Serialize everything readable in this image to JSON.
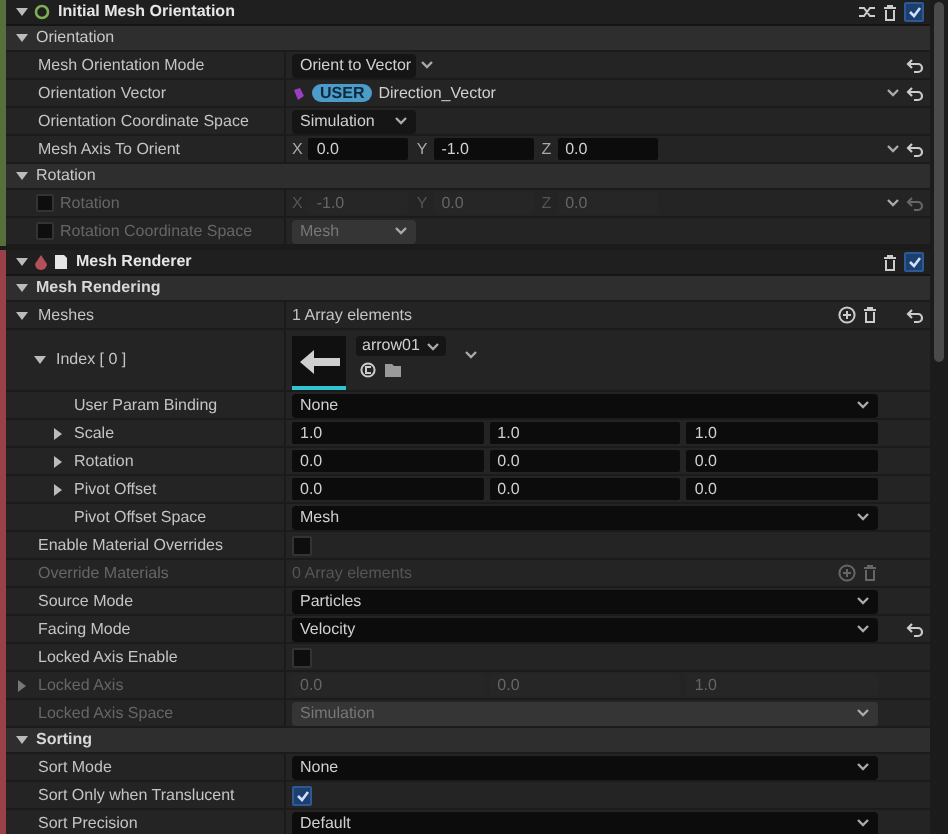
{
  "modules": [
    {
      "kind": "module",
      "title": "Initial Mesh Orientation",
      "color": "#55703a",
      "enabled": true,
      "expanded": true,
      "categories": [
        {
          "title": "Orientation",
          "expanded": true,
          "rows": [
            {
              "kind": "combo",
              "label": "Mesh Orientation Mode",
              "value": "Orient to Vector",
              "modified": true,
              "disabled": false
            },
            {
              "kind": "binding",
              "label": "Orientation Vector",
              "badge": "USER",
              "value": "Direction_Vector",
              "modified": true,
              "menu": true,
              "disabled": false
            },
            {
              "kind": "combo",
              "label": "Orientation Coordinate Space",
              "value": "Simulation",
              "modified": false,
              "disabled": false
            },
            {
              "kind": "vector",
              "label": "Mesh Axis To Orient",
              "fields": [
                {
                  "axis": "X",
                  "value": "0.0"
                },
                {
                  "axis": "Y",
                  "value": "-1.0"
                },
                {
                  "axis": "Z",
                  "value": "0.0"
                }
              ],
              "modified": true,
              "menu": true,
              "disabled": false
            }
          ]
        },
        {
          "title": "Rotation",
          "expanded": true,
          "rows": [
            {
              "kind": "vector",
              "label": "Rotation",
              "edit_condition": false,
              "fields": [
                {
                  "axis": "X",
                  "value": "-1.0"
                },
                {
                  "axis": "Y",
                  "value": "0.0"
                },
                {
                  "axis": "Z",
                  "value": "0.0"
                }
              ],
              "modified": true,
              "menu": true,
              "disabled": true
            },
            {
              "kind": "combo",
              "label": "Rotation Coordinate Space",
              "edit_condition": false,
              "value": "Mesh",
              "modified": false,
              "disabled": true
            }
          ]
        }
      ]
    },
    {
      "kind": "renderer",
      "title": "Mesh Renderer",
      "color": "#9a4048",
      "enabled": true,
      "expanded": true,
      "categories": [
        {
          "title": "Mesh Rendering",
          "expanded": true,
          "rows": [
            {
              "kind": "array",
              "label": "Meshes",
              "value": "1 Array elements",
              "expanded": true,
              "modified": true,
              "disabled": false,
              "children": [
                {
                  "kind": "mesh",
                  "label": "Index [ 0 ]",
                  "asset": "arrow01",
                  "expanded": true,
                  "disabled": false,
                  "children": [
                    {
                      "kind": "dropdown",
                      "label": "User Param Binding",
                      "value": "None",
                      "disabled": false
                    },
                    {
                      "kind": "vector3",
                      "label": "Scale",
                      "expanded": false,
                      "fields": [
                        {
                          "value": "1.0"
                        },
                        {
                          "value": "1.0"
                        },
                        {
                          "value": "1.0"
                        }
                      ],
                      "disabled": false
                    },
                    {
                      "kind": "vector3",
                      "label": "Rotation",
                      "expanded": false,
                      "fields": [
                        {
                          "value": "0.0"
                        },
                        {
                          "value": "0.0"
                        },
                        {
                          "value": "0.0"
                        }
                      ],
                      "disabled": false
                    },
                    {
                      "kind": "vector3",
                      "label": "Pivot Offset",
                      "expanded": false,
                      "fields": [
                        {
                          "value": "0.0"
                        },
                        {
                          "value": "0.0"
                        },
                        {
                          "value": "0.0"
                        }
                      ],
                      "disabled": false
                    },
                    {
                      "kind": "dropdown",
                      "label": "Pivot Offset Space",
                      "value": "Mesh",
                      "disabled": false
                    }
                  ]
                }
              ]
            },
            {
              "kind": "checkbox",
              "label": "Enable Material Overrides",
              "checked": false,
              "disabled": false
            },
            {
              "kind": "array",
              "label": "Override Materials",
              "value": "0 Array elements",
              "modified": false,
              "disabled": true
            },
            {
              "kind": "dropdown",
              "label": "Source Mode",
              "value": "Particles",
              "disabled": false
            },
            {
              "kind": "dropdown",
              "label": "Facing Mode",
              "value": "Velocity",
              "modified": true,
              "disabled": false
            },
            {
              "kind": "checkbox",
              "label": "Locked Axis Enable",
              "checked": false,
              "disabled": false
            },
            {
              "kind": "vector3",
              "label": "Locked Axis",
              "expanded": false,
              "fields": [
                {
                  "value": "0.0"
                },
                {
                  "value": "0.0"
                },
                {
                  "value": "1.0"
                }
              ],
              "disabled": true
            },
            {
              "kind": "dropdown",
              "label": "Locked Axis Space",
              "value": "Simulation",
              "disabled": true
            }
          ]
        },
        {
          "title": "Sorting",
          "expanded": true,
          "rows": [
            {
              "kind": "dropdown",
              "label": "Sort Mode",
              "value": "None",
              "disabled": false
            },
            {
              "kind": "checkbox",
              "label": "Sort Only when Translucent",
              "checked": true,
              "disabled": false
            },
            {
              "kind": "dropdown",
              "label": "Sort Precision",
              "value": "Default",
              "disabled": false
            }
          ]
        }
      ]
    }
  ]
}
